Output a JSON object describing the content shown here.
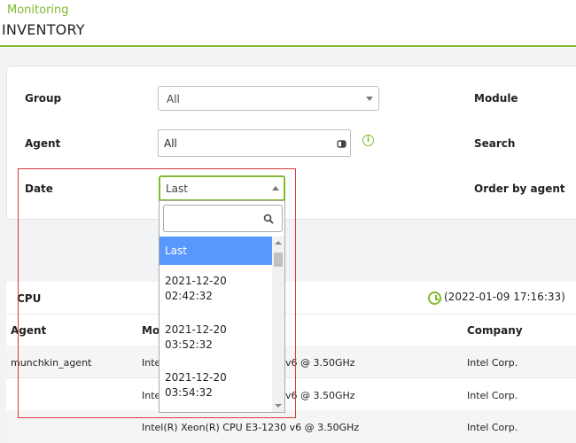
{
  "header": {
    "breadcrumb": "Monitoring",
    "title": "INVENTORY"
  },
  "filters": {
    "group_label": "Group",
    "group_value": "All",
    "module_label": "Module",
    "agent_label": "Agent",
    "agent_value": "All",
    "search_label": "Search",
    "date_label": "Date",
    "date_value": "Last",
    "order_label": "Order by agent"
  },
  "dropdown": {
    "search_placeholder": "",
    "options": [
      {
        "line1": "Last",
        "line2": ""
      },
      {
        "line1": "2021-12-20",
        "line2": "02:42:32"
      },
      {
        "line1": "2021-12-20",
        "line2": "03:52:32"
      },
      {
        "line1": "2021-12-20",
        "line2": "03:54:32"
      }
    ]
  },
  "table": {
    "section_title": "CPU",
    "timestamp": "(2022-01-09 17:16:33)",
    "headers": {
      "agent": "Agent",
      "model": "Mo",
      "company": "Company"
    },
    "rows": [
      {
        "agent": "munchkin_agent",
        "model_left": "Inte",
        "model_right": "v6 @ 3.50GHz",
        "company": "Intel Corp."
      },
      {
        "agent": "",
        "model_left": "Inte",
        "model_right": "v6 @ 3.50GHz",
        "company": "Intel Corp."
      },
      {
        "agent": "",
        "model_full": "Intel(R) Xeon(R) CPU E3-1230 v6 @ 3.50GHz",
        "company": "Intel Corp."
      }
    ]
  }
}
